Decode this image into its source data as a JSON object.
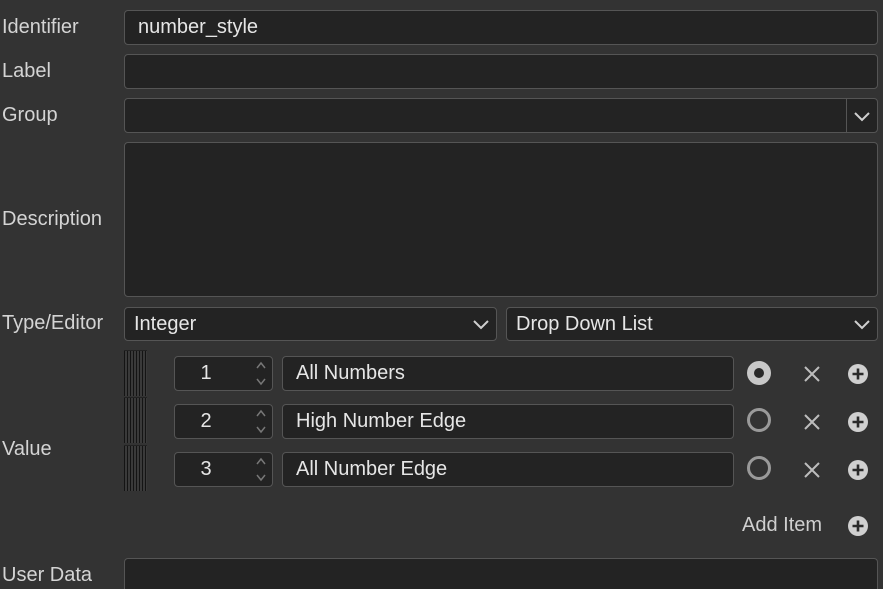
{
  "form": {
    "identifier_label": "Identifier",
    "identifier_value": "number_style",
    "label_label": "Label",
    "label_value": "",
    "group_label": "Group",
    "group_value": "",
    "description_label": "Description",
    "description_value": "",
    "type_editor_label": "Type/Editor",
    "type_value": "Integer",
    "editor_value": "Drop Down List",
    "value_label": "Value",
    "user_data_label": "User Data",
    "user_data_value": ""
  },
  "value_items": [
    {
      "number": "1",
      "text": "All Numbers",
      "selected": true
    },
    {
      "number": "2",
      "text": "High Number Edge",
      "selected": false
    },
    {
      "number": "3",
      "text": "All Number Edge",
      "selected": false
    }
  ],
  "add_item_label": "Add Item",
  "colors": {
    "background": "#333333",
    "field_background": "#232323",
    "border": "#555555",
    "text": "#dcdcdc"
  },
  "icons": {
    "dropdown": "chevron-down-icon",
    "spinner": "up-down-arrows-icon",
    "radio_selected": "radio-selected-icon",
    "radio_unselected": "radio-unselected-icon",
    "remove": "close-icon",
    "add": "plus-circle-icon"
  }
}
